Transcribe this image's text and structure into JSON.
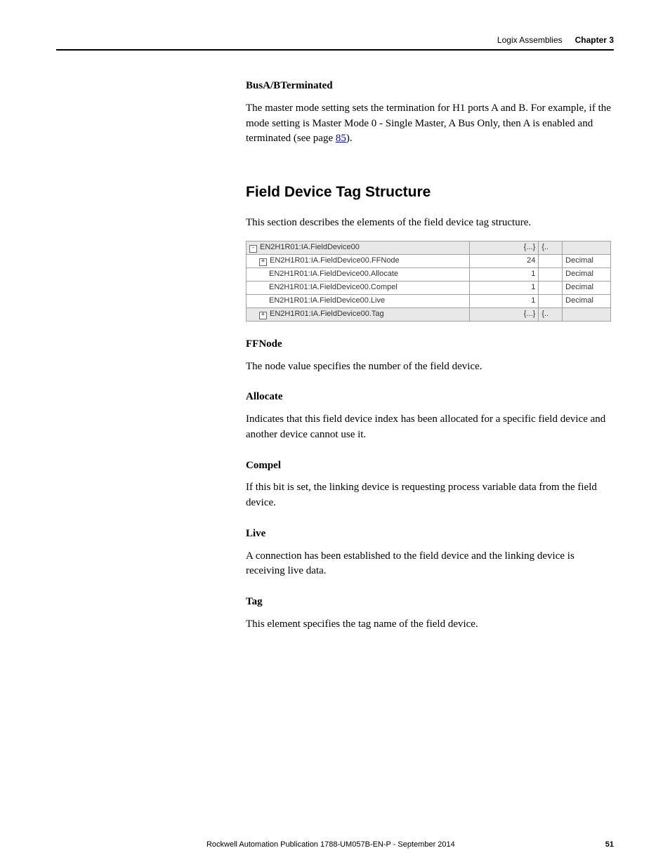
{
  "header": {
    "chapter_title": "Logix Assemblies",
    "chapter_label": "Chapter 3"
  },
  "bus": {
    "heading": "BusA/BTerminated",
    "para_a": "The master mode setting sets the termination for H1 ports A and B. For example, if the mode setting is Master Mode 0 - Single Master, A Bus Only, then A is enabled and terminated (see page ",
    "link": "85",
    "para_b": ")."
  },
  "section_title": "Field Device Tag Structure",
  "section_intro": "This section describes the elements of the field device tag structure.",
  "table": {
    "rows": [
      {
        "toggle": "-",
        "indent": 0,
        "name": "EN2H1R01:IA.FieldDevice00",
        "value": "{...}",
        "c": "{..",
        "type": "",
        "bg": "grey"
      },
      {
        "toggle": "+",
        "indent": 1,
        "name": "EN2H1R01:IA.FieldDevice00.FFNode",
        "value": "24",
        "c": "",
        "type": "Decimal",
        "bg": "white"
      },
      {
        "toggle": "",
        "indent": 2,
        "name": "EN2H1R01:IA.FieldDevice00.Allocate",
        "value": "1",
        "c": "",
        "type": "Decimal",
        "bg": "white"
      },
      {
        "toggle": "",
        "indent": 2,
        "name": "EN2H1R01:IA.FieldDevice00.Compel",
        "value": "1",
        "c": "",
        "type": "Decimal",
        "bg": "white"
      },
      {
        "toggle": "",
        "indent": 2,
        "name": "EN2H1R01:IA.FieldDevice00.Live",
        "value": "1",
        "c": "",
        "type": "Decimal",
        "bg": "white"
      },
      {
        "toggle": "+",
        "indent": 1,
        "name": "EN2H1R01:IA.FieldDevice00.Tag",
        "value": "{...}",
        "c": "{..",
        "type": "",
        "bg": "grey"
      }
    ]
  },
  "defs": [
    {
      "heading": "FFNode",
      "text": "The node value specifies the number of the field device."
    },
    {
      "heading": "Allocate",
      "text": "Indicates that this field device index has been allocated for a specific field device and another device cannot use it."
    },
    {
      "heading": "Compel",
      "text": "If this bit is set, the linking device is requesting process variable data from the field device."
    },
    {
      "heading": "Live",
      "text": "A connection has been established to the field device and the linking device is receiving live data."
    },
    {
      "heading": "Tag",
      "text": "This element specifies the tag name of the field device."
    }
  ],
  "footer": {
    "publication": "Rockwell Automation Publication 1788-UM057B-EN-P - September 2014",
    "page": "51"
  }
}
